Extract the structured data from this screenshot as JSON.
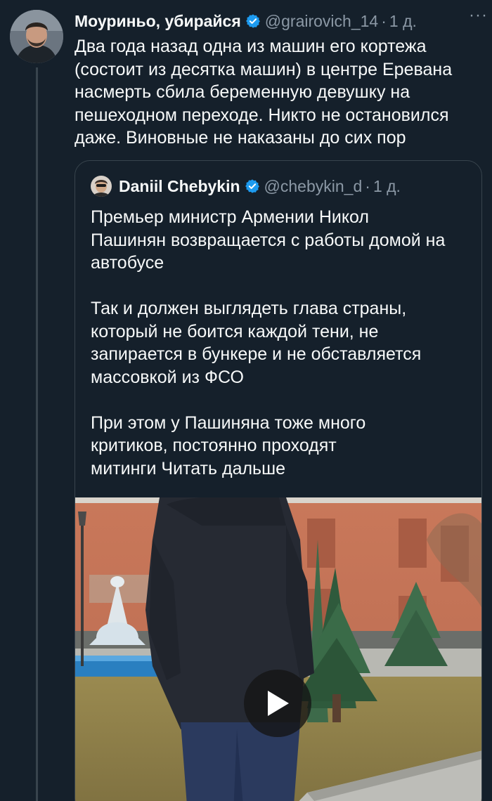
{
  "tweet": {
    "author_name": "Моуриньо, убирайся",
    "author_handle": "@grairovich_14",
    "separator": "·",
    "time": "1 д.",
    "more_label": "···",
    "text": "Два года назад одна из машин его кортежа\n(состоит из десятка машин) в центре Еревана\nнасмерть сбила беременную девушку на\nпешеходном переходе. Никто не остановился\nдаже. Виновные не наказаны до сих пор"
  },
  "quoted_tweet": {
    "author_name": "Daniil Chebykin",
    "author_handle": "@chebykin_d",
    "separator": "·",
    "time": "1 д.",
    "text": "Премьер министр Армении Никол\nПашинян возвращается с работы домой на\nавтобусе\n\nТак и должен выглядеть глава страны,\nкоторый не боится каждой тени, не\nзапирается в бункере и не обставляется\nмассовкой из ФСО\n\nПри этом у Пашиняна тоже много\nкритиков, постоянно проходят\nмитинги ",
    "read_more": "Читать дальше"
  },
  "colors": {
    "background": "#15202b",
    "text_primary": "#f7f9f9",
    "text_secondary": "#8b98a5",
    "verified": "#1d9bf0",
    "border": "#38444d"
  },
  "icons": {
    "verified": "verified-badge-icon",
    "more": "more-options-icon",
    "play": "play-icon"
  }
}
